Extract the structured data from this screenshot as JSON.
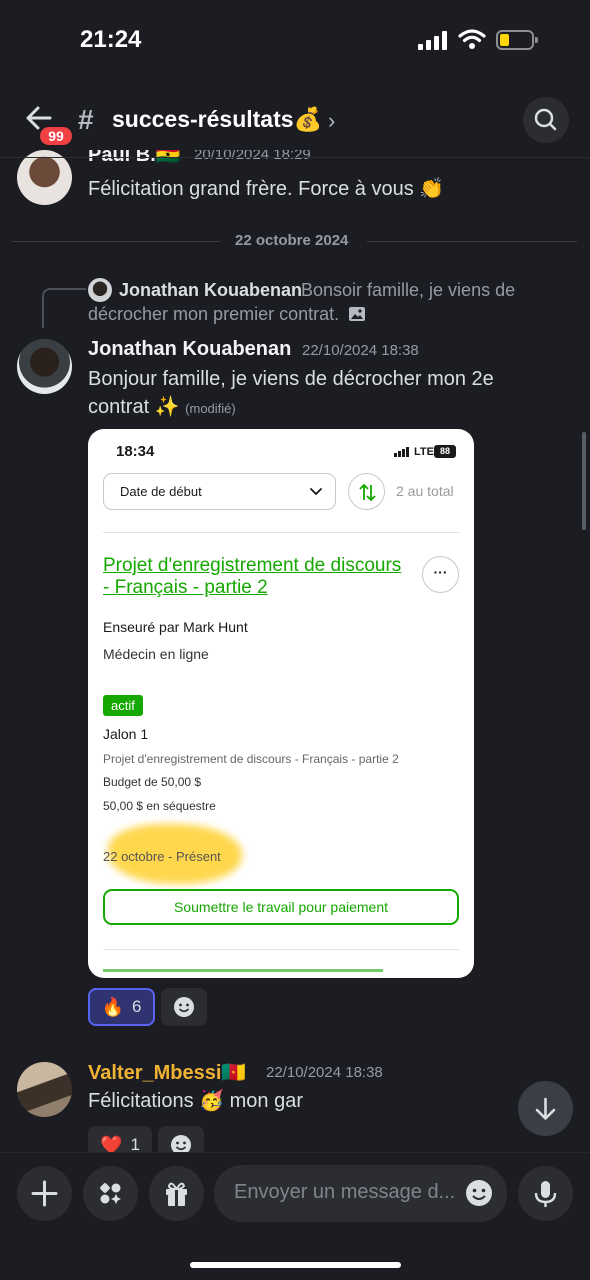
{
  "status_bar": {
    "time": "21:24",
    "battery_level": 0.2
  },
  "header": {
    "unread_badge": "99",
    "hash": "#",
    "channel_name": "succes-résultats💰",
    "chevron": "›"
  },
  "messages": [
    {
      "author": "Paul B.🇬🇭",
      "timestamp": "20/10/2024 18:29",
      "text": "Félicitation grand frère. Force à vous 👏"
    }
  ],
  "date_divider": "22 octobre 2024",
  "reply": {
    "author": "Jonathan Kouabenan",
    "text": "Bonsoir famille, je viens de décrocher mon premier contrat.",
    "image_icon": "image-icon"
  },
  "main_message": {
    "author": "Jonathan Kouabenan",
    "timestamp": "22/10/2024 18:38",
    "text": "Bonjour famille, je viens de décrocher mon 2e contrat ✨",
    "edited": "(modifié)"
  },
  "embedded_screenshot": {
    "time": "18:34",
    "network": "LTE",
    "battery": "88",
    "sort_select": "Date de début",
    "total": "2 au total",
    "project_title": "Projet d'enregistrement de discours - Français - partie 2",
    "more": "···",
    "client": "Enseuré par Mark Hunt",
    "category": "Médecin en ligne",
    "status": "actif",
    "milestone": "Jalon 1",
    "milestone_desc": "Projet d'enregistrement de discours - Français - partie 2",
    "budget": "Budget de 50,00 $",
    "escrow": "50,00 $ en séquestre",
    "dates": "22 octobre - Présent",
    "submit_label": "Soumettre le travail pour paiement"
  },
  "reactions_main": [
    {
      "emoji": "🔥",
      "count": "6",
      "mine": true
    },
    {
      "emoji": "add-reaction-icon",
      "count": ""
    }
  ],
  "message_valter": {
    "author": "Valter_Mbessi🇨🇲",
    "author_color": "#f0b232",
    "timestamp": "22/10/2024 18:38",
    "text": "Félicitations 🥳 mon gar"
  },
  "reactions_valter": [
    {
      "emoji": "❤️",
      "count": "1"
    },
    {
      "emoji": "add-reaction-icon",
      "count": ""
    }
  ],
  "composer": {
    "placeholder": "Envoyer un message d..."
  },
  "colors": {
    "background": "#1c1d22",
    "accent": "#5865f2",
    "upwork_green": "#14a800",
    "badge_red": "#f23f43"
  }
}
